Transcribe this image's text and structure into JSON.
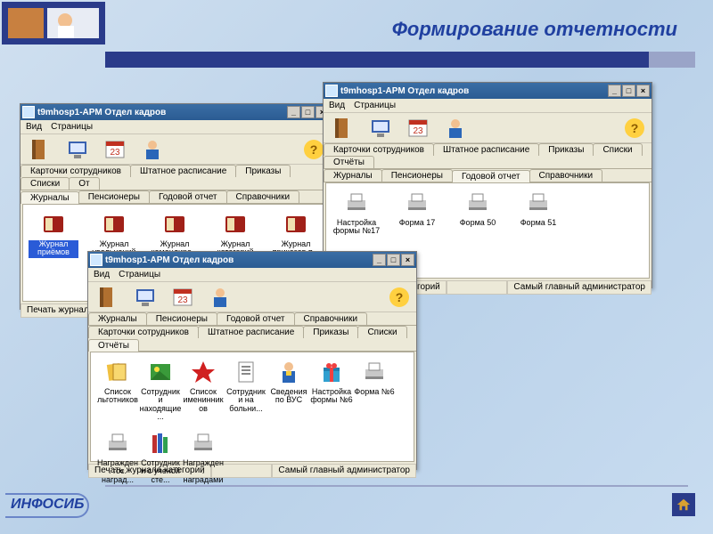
{
  "slide": {
    "title": "Формирование отчетности",
    "footer_brand": "ИНФОСИБ"
  },
  "common": {
    "menu_view": "Вид",
    "menu_pages": "Страницы",
    "help": "?",
    "status_left": "Печать журнала категорий",
    "status_right": "Самый главный администратор",
    "tabs": {
      "cards": "Карточки сотрудников",
      "staff": "Штатное расписание",
      "orders": "Приказы",
      "lists": "Списки",
      "reports": "Отчёты",
      "journals": "Журналы",
      "pension": "Пенсионеры",
      "annual": "Годовой отчет",
      "refs": "Справочники"
    }
  },
  "windows": {
    "a": {
      "title": "t9mhosp1-АРМ Отдел кадров",
      "items": [
        {
          "label": "Журнал приёмов",
          "icon": "book",
          "selected": true
        },
        {
          "label": "Журнал увольнений",
          "icon": "book"
        },
        {
          "label": "Журнал командиро...",
          "icon": "book"
        },
        {
          "label": "Журнал категорий",
          "icon": "book"
        },
        {
          "label": "Журнал приказов п...",
          "icon": "book"
        }
      ]
    },
    "b": {
      "title": "t9mhosp1-АРМ Отдел кадров",
      "items": [
        {
          "label": "Настройка формы №17",
          "icon": "printer"
        },
        {
          "label": "Форма 17",
          "icon": "printer"
        },
        {
          "label": "Форма 50",
          "icon": "printer"
        },
        {
          "label": "Форма 51",
          "icon": "printer"
        }
      ]
    },
    "c": {
      "title": "t9mhosp1-АРМ Отдел кадров",
      "row1": [
        {
          "label": "Список льготников",
          "icon": "cards"
        },
        {
          "label": "Сотрудники находящие...",
          "icon": "photo"
        },
        {
          "label": "Список именинников",
          "icon": "star"
        },
        {
          "label": "Сотрудники на больни...",
          "icon": "doc"
        },
        {
          "label": "Сведения по ВУС",
          "icon": "man"
        },
        {
          "label": "Настройка формы №6",
          "icon": "gift"
        },
        {
          "label": "Форма №6",
          "icon": "printer"
        }
      ],
      "row2": [
        {
          "label": "Награжден. гос. наград...",
          "icon": "printer"
        },
        {
          "label": "Сотрудники с ученой сте...",
          "icon": "books"
        },
        {
          "label": "Награжден. наградами",
          "icon": "printer"
        }
      ]
    }
  }
}
